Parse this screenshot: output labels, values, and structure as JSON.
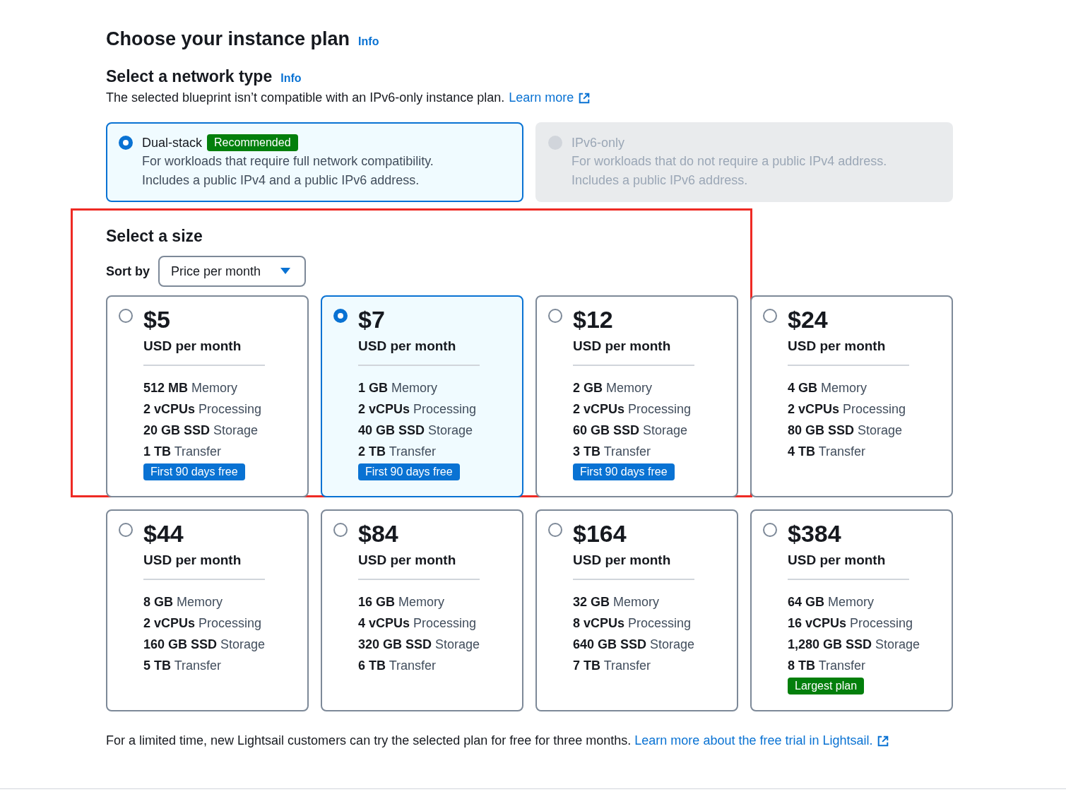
{
  "title": "Choose your instance plan",
  "title_info": "Info",
  "network": {
    "heading": "Select a network type",
    "info": "Info",
    "note": "The selected blueprint isn’t compatible with an IPv6-only instance plan.",
    "link": "Learn more",
    "options": [
      {
        "label": "Dual-stack",
        "badge": "Recommended",
        "lines": [
          "For workloads that require full network compatibility.",
          "Includes a public IPv4 and a public IPv6 address."
        ],
        "selected": true,
        "disabled": false
      },
      {
        "label": "IPv6-only",
        "lines": [
          "For workloads that do not require a public IPv4 address.",
          "Includes a public IPv6 address."
        ],
        "selected": false,
        "disabled": true
      }
    ]
  },
  "size": {
    "heading": "Select a size",
    "highlight": true,
    "sort_label": "Sort by",
    "sort_value": "Price per month",
    "plans": [
      {
        "price": "$5",
        "period": "USD per month",
        "specs": [
          [
            "512 MB",
            "Memory"
          ],
          [
            "2 vCPUs",
            "Processing"
          ],
          [
            "20 GB SSD",
            "Storage"
          ],
          [
            "1 TB",
            "Transfer"
          ]
        ],
        "badge": {
          "kind": "free",
          "text": "First 90 days free"
        },
        "selected": false
      },
      {
        "price": "$7",
        "period": "USD per month",
        "specs": [
          [
            "1 GB",
            "Memory"
          ],
          [
            "2 vCPUs",
            "Processing"
          ],
          [
            "40 GB SSD",
            "Storage"
          ],
          [
            "2 TB",
            "Transfer"
          ]
        ],
        "badge": {
          "kind": "free",
          "text": "First 90 days free"
        },
        "selected": true
      },
      {
        "price": "$12",
        "period": "USD per month",
        "specs": [
          [
            "2 GB",
            "Memory"
          ],
          [
            "2 vCPUs",
            "Processing"
          ],
          [
            "60 GB SSD",
            "Storage"
          ],
          [
            "3 TB",
            "Transfer"
          ]
        ],
        "badge": {
          "kind": "free",
          "text": "First 90 days free"
        },
        "selected": false
      },
      {
        "price": "$24",
        "period": "USD per month",
        "specs": [
          [
            "4 GB",
            "Memory"
          ],
          [
            "2 vCPUs",
            "Processing"
          ],
          [
            "80 GB SSD",
            "Storage"
          ],
          [
            "4 TB",
            "Transfer"
          ]
        ],
        "selected": false
      },
      {
        "price": "$44",
        "period": "USD per month",
        "specs": [
          [
            "8 GB",
            "Memory"
          ],
          [
            "2 vCPUs",
            "Processing"
          ],
          [
            "160 GB SSD",
            "Storage"
          ],
          [
            "5 TB",
            "Transfer"
          ]
        ],
        "selected": false
      },
      {
        "price": "$84",
        "period": "USD per month",
        "specs": [
          [
            "16 GB",
            "Memory"
          ],
          [
            "4 vCPUs",
            "Processing"
          ],
          [
            "320 GB SSD",
            "Storage"
          ],
          [
            "6 TB",
            "Transfer"
          ]
        ],
        "selected": false
      },
      {
        "price": "$164",
        "period": "USD per month",
        "specs": [
          [
            "32 GB",
            "Memory"
          ],
          [
            "8 vCPUs",
            "Processing"
          ],
          [
            "640 GB SSD",
            "Storage"
          ],
          [
            "7 TB",
            "Transfer"
          ]
        ],
        "selected": false
      },
      {
        "price": "$384",
        "period": "USD per month",
        "specs": [
          [
            "64 GB",
            "Memory"
          ],
          [
            "16 vCPUs",
            "Processing"
          ],
          [
            "1,280 GB SSD",
            "Storage"
          ],
          [
            "8 TB",
            "Transfer"
          ]
        ],
        "badge": {
          "kind": "largest",
          "text": "Largest plan"
        },
        "selected": false
      }
    ]
  },
  "footer": {
    "text": "For a limited time, new Lightsail customers can try the selected plan for free for three months.",
    "link": "Learn more about the free trial in Lightsail."
  }
}
